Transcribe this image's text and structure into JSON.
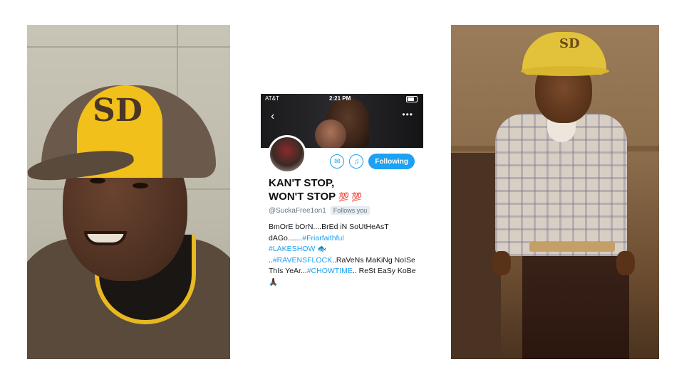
{
  "status_bar": {
    "carrier": "AT&T",
    "time": "2:21 PM"
  },
  "banner": {
    "back_icon": "chevron-left-icon",
    "more_icon": "more-dots-icon"
  },
  "actions": {
    "message_icon": "envelope-icon",
    "notify_icon": "bell-plus-icon",
    "follow_label": "Following"
  },
  "profile": {
    "name_line1": "KAN'T STOP,",
    "name_line2": "WON'T STOP",
    "name_emoji": "💯 💯",
    "handle": "@SuckaFree1on1",
    "follows_you": "Follows you"
  },
  "bio": {
    "part1": "BmOrE bOrN....BrEd iN SoUtHeAsT dAGo.......",
    "tag1": "#Friarfaithful",
    "tag2": "#LAKESHOW",
    "part2": " 🐟 ..",
    "tag3": "#RAVENSFLOCK",
    "part3": "..RaVeNs MaKiNg NoISe ThIs YeAr...",
    "tag4": "#CHOWTIME",
    "part4": ".. ReSt EaSy KoBe 🙏🏿"
  },
  "photo_left": {
    "cap_logo": "SD"
  },
  "photo_right": {
    "cap_logo": "SD"
  },
  "colors": {
    "accent": "#1da1f2",
    "padres_gold": "#f2c01a",
    "padres_brown": "#5a4a3c"
  }
}
